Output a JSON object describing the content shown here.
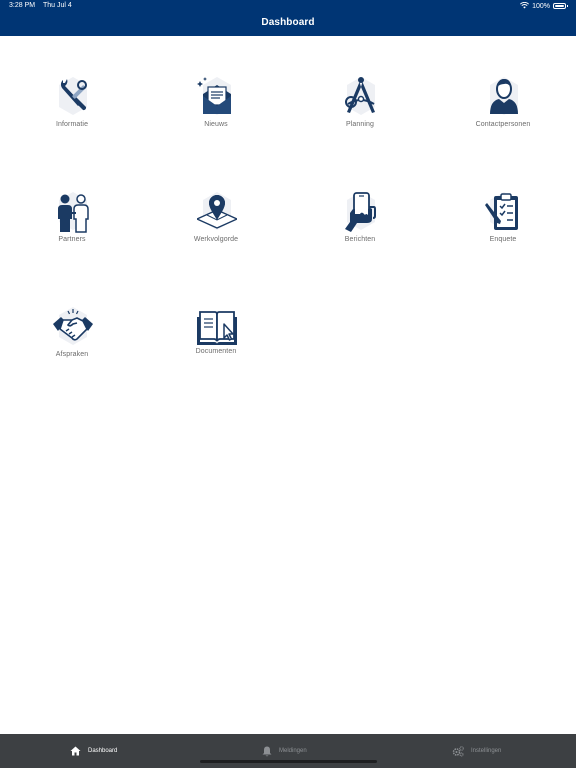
{
  "status_bar": {
    "time": "3:28 PM",
    "date": "Thu Jul 4",
    "battery": "100%",
    "battery_level": 1.0
  },
  "header": {
    "title": "Dashboard",
    "background": "#003574"
  },
  "dashboard": {
    "accent": "#1b3a63",
    "tiles": [
      {
        "label": "Informatie",
        "icon": "tools-icon"
      },
      {
        "label": "Nieuws",
        "icon": "newsletter-icon"
      },
      {
        "label": "Planning",
        "icon": "compass-icon"
      },
      {
        "label": "Contactpersonen",
        "icon": "person-icon"
      },
      {
        "label": "Partners",
        "icon": "partners-icon"
      },
      {
        "label": "Werkvolgorde",
        "icon": "map-pin-icon"
      },
      {
        "label": "Berichten",
        "icon": "phone-hand-icon"
      },
      {
        "label": "Enquete",
        "icon": "clipboard-icon"
      },
      {
        "label": "Afspraken",
        "icon": "handshake-icon"
      },
      {
        "label": "Documenten",
        "icon": "book-cursor-icon"
      }
    ]
  },
  "tabbar": {
    "tabs": [
      {
        "label": "Dashboard",
        "icon": "home-icon",
        "active": true
      },
      {
        "label": "Meldingen",
        "icon": "bell-icon",
        "active": false
      },
      {
        "label": "Instellingen",
        "icon": "gears-icon",
        "active": false
      }
    ]
  }
}
